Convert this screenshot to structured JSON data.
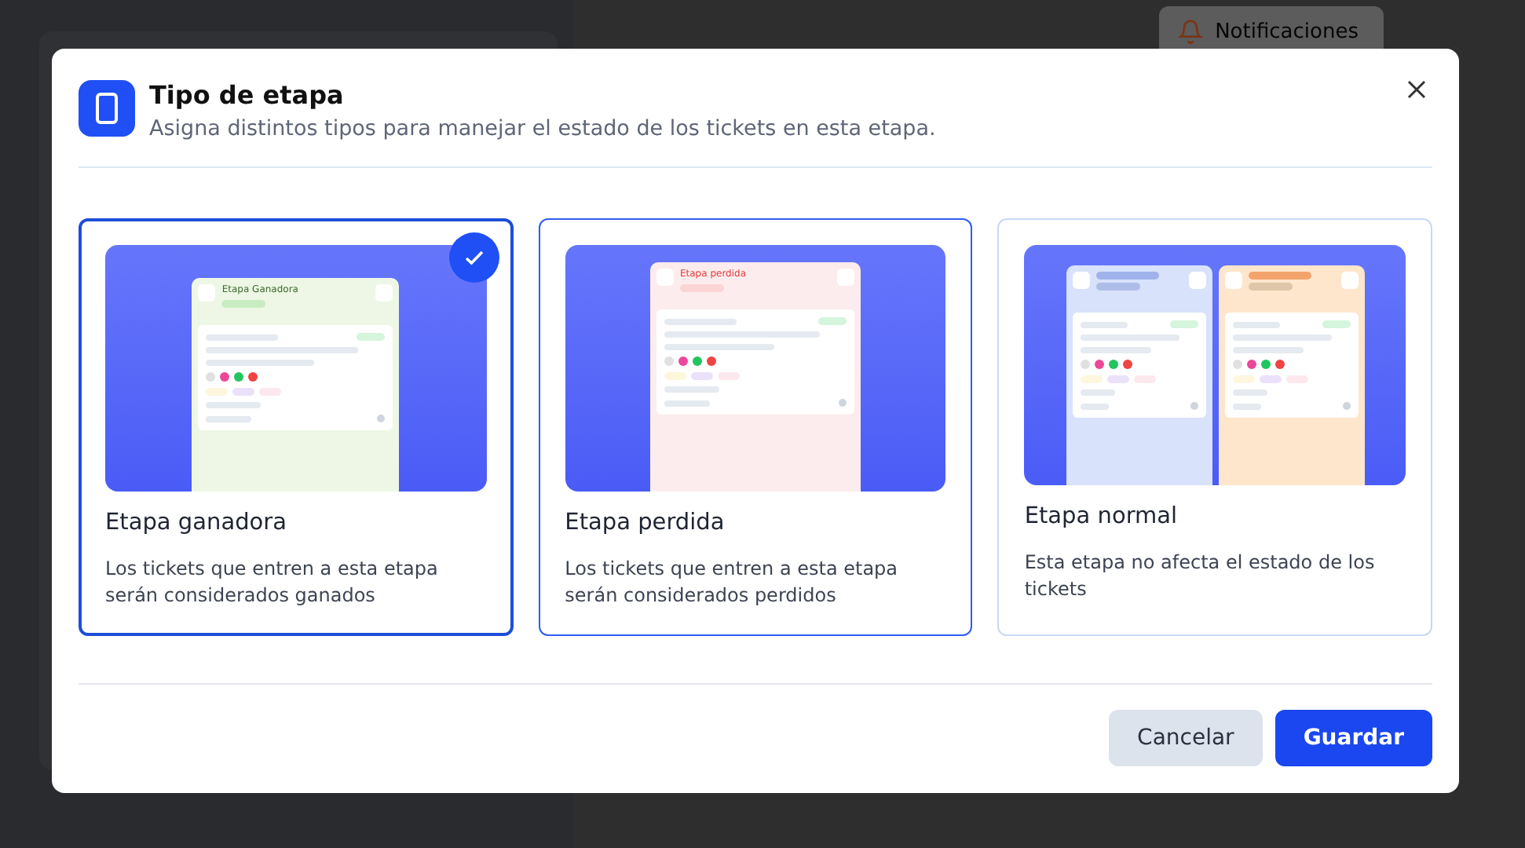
{
  "background": {
    "notifications_button": "Notificaciones"
  },
  "dialog": {
    "title": "Tipo de etapa",
    "subtitle": "Asigna distintos tipos para manejar el estado de los tickets en esta etapa.",
    "options": [
      {
        "kind": "won",
        "title": "Etapa ganadora",
        "description": "Los tickets que entren a esta etapa serán considerados ganados",
        "preview_title": "Etapa Ganadora",
        "selected": true,
        "hovered": false
      },
      {
        "kind": "lost",
        "title": "Etapa perdida",
        "description": "Los tickets que entren a esta etapa serán considerados perdidos",
        "preview_title": "Etapa perdida",
        "selected": false,
        "hovered": true
      },
      {
        "kind": "normal",
        "title": "Etapa normal",
        "description": "Esta etapa no afecta el estado de los tickets",
        "selected": false,
        "hovered": false
      }
    ],
    "buttons": {
      "cancel": "Cancelar",
      "save": "Guardar"
    }
  }
}
